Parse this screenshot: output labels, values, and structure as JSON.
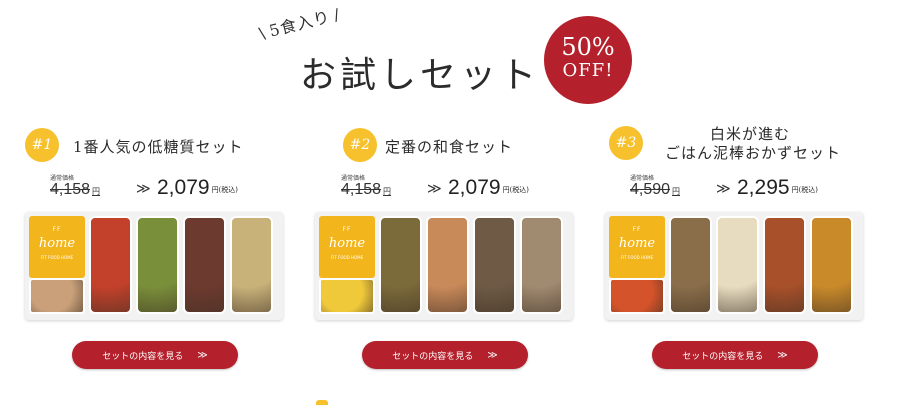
{
  "header": {
    "subtitle": "5食入り",
    "title": "お試しセット",
    "badge_percent": "50%",
    "badge_off": "OFF!"
  },
  "cards": [
    {
      "rank": "#1",
      "title": "1番人気の低糖質セット",
      "regular_label": "通常価格",
      "regular_price": "4,158",
      "regular_unit": "円",
      "arrow": "≫",
      "sale_price": "2,079",
      "sale_unit": "円(税込)",
      "logo_ff": "FF",
      "logo_home": "home",
      "logo_sub": "FIT FOOD HOME",
      "button": "セットの内容を見る",
      "button_arrow": "≫",
      "food_colors": [
        "#c9a07a",
        "#c3412b",
        "#7a8f3a",
        "#6d3a2f",
        "#c9b27a"
      ]
    },
    {
      "rank": "#2",
      "title": "定番の和食セット",
      "regular_label": "通常価格",
      "regular_price": "4,158",
      "regular_unit": "円",
      "arrow": "≫",
      "sale_price": "2,079",
      "sale_unit": "円(税込)",
      "logo_ff": "FF",
      "logo_home": "home",
      "logo_sub": "FIT FOOD HOME",
      "button": "セットの内容を見る",
      "button_arrow": "≫",
      "food_colors": [
        "#f0c93a",
        "#7b6a3a",
        "#c98a5a",
        "#6e5a45",
        "#a08a70"
      ]
    },
    {
      "rank": "#3",
      "title": "白米が進む",
      "title2": "ごはん泥棒おかずセット",
      "regular_label": "通常価格",
      "regular_price": "4,590",
      "regular_unit": "円",
      "arrow": "≫",
      "sale_price": "2,295",
      "sale_unit": "円(税込)",
      "logo_ff": "FF",
      "logo_home": "home",
      "logo_sub": "FIT FOOD HOME",
      "button": "セットの内容を見る",
      "button_arrow": "≫",
      "food_colors": [
        "#d4532a",
        "#8a6e4a",
        "#e8dcc0",
        "#a8502a",
        "#c98a2a"
      ]
    }
  ]
}
